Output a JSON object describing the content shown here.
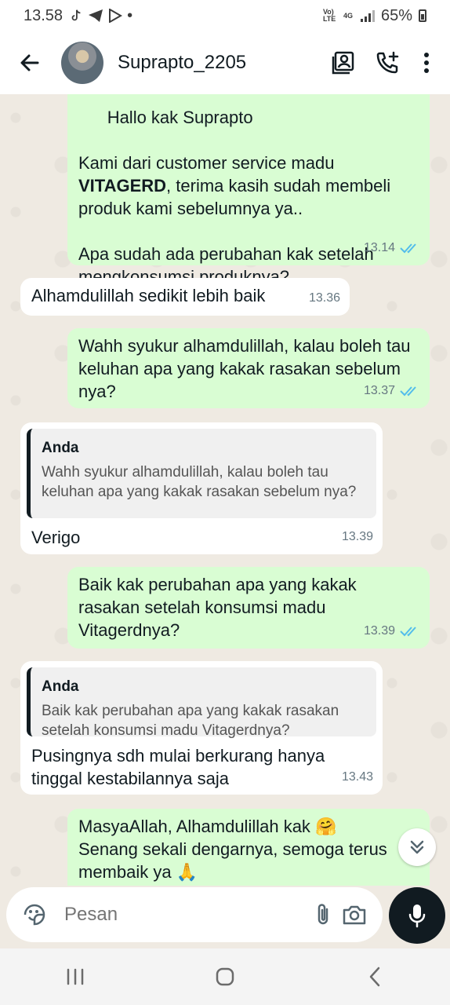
{
  "status": {
    "time": "13.58",
    "lte": "Vo) LTE",
    "net": "4G",
    "battery": "65%"
  },
  "header": {
    "contact_name": "Suprapto_2205"
  },
  "messages": [
    {
      "direction": "out",
      "partial_top": "Hallo kak Suprapto",
      "text_before_bold": "Kami dari customer service madu ",
      "bold": "VITAGERD",
      "text_after_bold": ", terima kasih sudah membeli produk kami sebelumnya ya..",
      "text2": "Apa sudah ada perubahan kak setelah mengkonsumsi produknya?",
      "time": "13.14"
    },
    {
      "direction": "in",
      "text": "Alhamdulillah sedikit lebih baik",
      "time": "13.36"
    },
    {
      "direction": "out",
      "text": "Wahh syukur alhamdulillah, kalau boleh tau keluhan apa yang kakak rasakan sebelum nya?",
      "time": "13.37"
    },
    {
      "direction": "in",
      "quote_author": "Anda",
      "quote_text": "Wahh syukur alhamdulillah, kalau boleh tau keluhan apa yang kakak rasakan sebelum nya?",
      "text": "Verigo",
      "time": "13.39"
    },
    {
      "direction": "out",
      "text": "Baik kak perubahan apa yang kakak rasakan setelah konsumsi madu Vitagerdnya?",
      "time": "13.39"
    },
    {
      "direction": "in",
      "quote_author": "Anda",
      "quote_text": "Baik kak perubahan apa yang kakak rasakan setelah konsumsi madu Vitagerdnya?",
      "text": "Pusingnya sdh mulai berkurang hanya tinggal kestabilannya saja",
      "time": "13.43"
    },
    {
      "direction": "out",
      "text": "MasyaAllah, Alhamdulillah kak 🤗\nSenang sekali dengarnya, semoga terus membaik ya 🙏"
    }
  ],
  "input": {
    "placeholder": "Pesan"
  },
  "colors": {
    "outgoing_bubble": "#d9fdd3",
    "incoming_bubble": "#ffffff",
    "read_ticks": "#53bdeb",
    "chat_background": "#efeae2"
  }
}
